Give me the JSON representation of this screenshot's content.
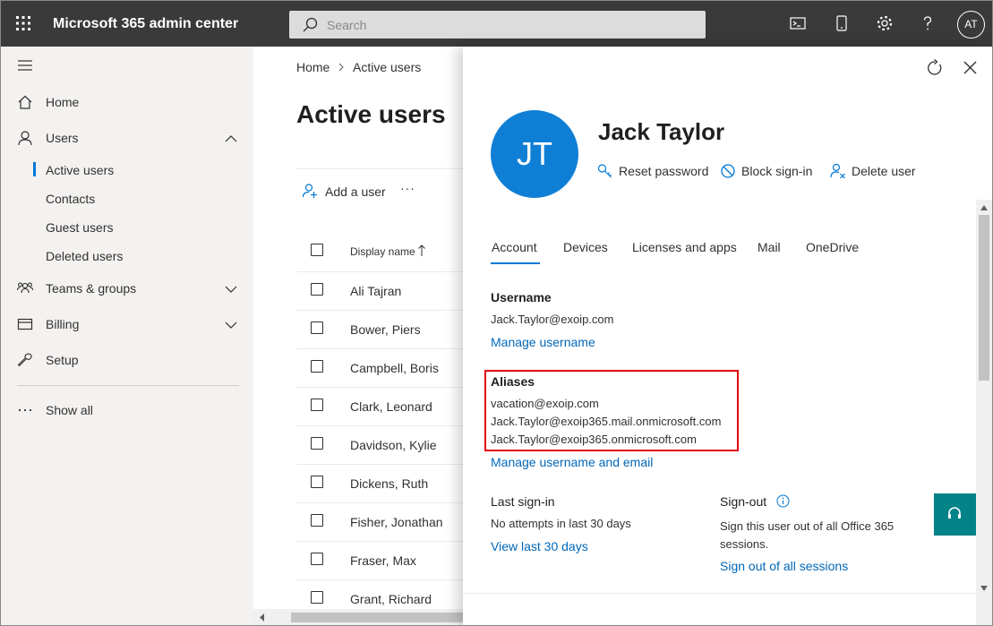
{
  "app": {
    "title": "Microsoft 365 admin center",
    "search_placeholder": "Search",
    "user_initials": "AT"
  },
  "sidebar": {
    "items": [
      {
        "label": "Home",
        "icon": "home-icon"
      },
      {
        "label": "Users",
        "icon": "user-icon",
        "expanded": true
      },
      {
        "label": "Teams & groups",
        "icon": "teams-icon"
      },
      {
        "label": "Billing",
        "icon": "billing-icon"
      },
      {
        "label": "Setup",
        "icon": "wrench-icon"
      },
      {
        "label": "Show all",
        "icon": "ellipsis-icon"
      }
    ],
    "users_sub": [
      "Active users",
      "Contacts",
      "Guest users",
      "Deleted users"
    ]
  },
  "main": {
    "breadcrumb": [
      "Home",
      "Active users"
    ],
    "title": "Active users",
    "add_user": "Add a user",
    "more": "···",
    "column_display_name": "Display name",
    "rows": [
      "Ali Tajran",
      "Bower, Piers",
      "Campbell, Boris",
      "Clark, Leonard",
      "Davidson, Kylie",
      "Dickens, Ruth",
      "Fisher, Jonathan",
      "Fraser, Max",
      "Grant, Richard"
    ]
  },
  "panel": {
    "initials": "JT",
    "name": "Jack Taylor",
    "actions": [
      "Reset password",
      "Block sign-in",
      "Delete user"
    ],
    "tabs": [
      "Account",
      "Devices",
      "Licenses and apps",
      "Mail",
      "OneDrive"
    ],
    "active_tab": "Account",
    "username_label": "Username",
    "username_value": "Jack.Taylor@exoip.com",
    "manage_username": "Manage username",
    "aliases_label": "Aliases",
    "aliases": [
      "vacation@exoip.com",
      "Jack.Taylor@exoip365.mail.onmicrosoft.com",
      "Jack.Taylor@exoip365.onmicrosoft.com"
    ],
    "manage_username_email": "Manage username and email",
    "last_signin_label": "Last sign-in",
    "last_signin_value": "No attempts in last 30 days",
    "view_last_30": "View last 30 days",
    "signout_label": "Sign-out",
    "signout_line1": "Sign this user out of all Office 365",
    "signout_line2": "sessions.",
    "signout_link": "Sign out of all sessions"
  },
  "colors": {
    "topbar": "#3a3a3a",
    "accent": "#0078d4",
    "avatar": "#0f7fd6",
    "link": "#0067b8",
    "highlight": "#e3000f",
    "fab": "#038387"
  }
}
